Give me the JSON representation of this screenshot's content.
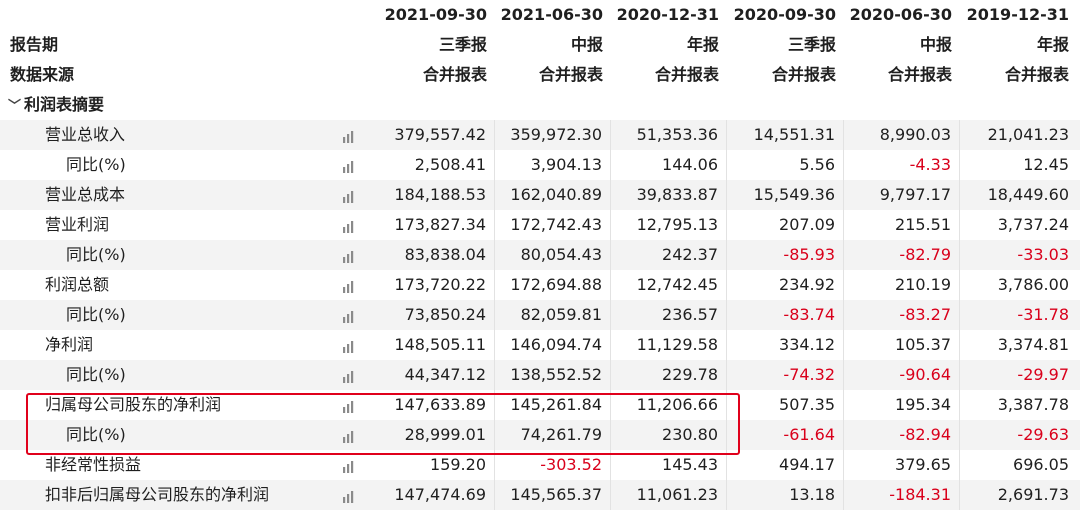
{
  "header": {
    "dates": [
      "2021-09-30",
      "2021-06-30",
      "2020-12-31",
      "2020-09-30",
      "2020-06-30",
      "2019-12-31"
    ],
    "report_period_label": "报告期",
    "report_types": [
      "三季报",
      "中报",
      "年报",
      "三季报",
      "中报",
      "年报"
    ],
    "data_source_label": "数据来源",
    "data_sources": [
      "合并报表",
      "合并报表",
      "合并报表",
      "合并报表",
      "合并报表",
      "合并报表"
    ]
  },
  "section": {
    "title": "利润表摘要",
    "chevron_icon": "chevron-down-icon"
  },
  "rows": [
    {
      "label": "营业总收入",
      "indent": 1,
      "values": [
        "379,557.42",
        "359,972.30",
        "51,353.36",
        "14,551.31",
        "8,990.03",
        "21,041.23"
      ]
    },
    {
      "label": "同比(%)",
      "indent": 2,
      "values": [
        "2,508.41",
        "3,904.13",
        "144.06",
        "5.56",
        "-4.33",
        "12.45"
      ]
    },
    {
      "label": "营业总成本",
      "indent": 1,
      "values": [
        "184,188.53",
        "162,040.89",
        "39,833.87",
        "15,549.36",
        "9,797.17",
        "18,449.60"
      ]
    },
    {
      "label": "营业利润",
      "indent": 1,
      "values": [
        "173,827.34",
        "172,742.43",
        "12,795.13",
        "207.09",
        "215.51",
        "3,737.24"
      ]
    },
    {
      "label": "同比(%)",
      "indent": 2,
      "values": [
        "83,838.04",
        "80,054.43",
        "242.37",
        "-85.93",
        "-82.79",
        "-33.03"
      ]
    },
    {
      "label": "利润总额",
      "indent": 1,
      "values": [
        "173,720.22",
        "172,694.88",
        "12,742.45",
        "234.92",
        "210.19",
        "3,786.00"
      ]
    },
    {
      "label": "同比(%)",
      "indent": 2,
      "values": [
        "73,850.24",
        "82,059.81",
        "236.57",
        "-83.74",
        "-83.27",
        "-31.78"
      ]
    },
    {
      "label": "净利润",
      "indent": 1,
      "values": [
        "148,505.11",
        "146,094.74",
        "11,129.58",
        "334.12",
        "105.37",
        "3,374.81"
      ]
    },
    {
      "label": "同比(%)",
      "indent": 2,
      "values": [
        "44,347.12",
        "138,552.52",
        "229.78",
        "-74.32",
        "-90.64",
        "-29.97"
      ]
    },
    {
      "label": "归属母公司股东的净利润",
      "indent": 1,
      "values": [
        "147,633.89",
        "145,261.84",
        "11,206.66",
        "507.35",
        "195.34",
        "3,387.78"
      ]
    },
    {
      "label": "同比(%)",
      "indent": 2,
      "values": [
        "28,999.01",
        "74,261.79",
        "230.80",
        "-61.64",
        "-82.94",
        "-29.63"
      ]
    },
    {
      "label": "非经常性损益",
      "indent": 1,
      "values": [
        "159.20",
        "-303.52",
        "145.43",
        "494.17",
        "379.65",
        "696.05"
      ]
    },
    {
      "label": "扣非后归属母公司股东的净利润",
      "indent": 1,
      "values": [
        "147,474.69",
        "145,565.37",
        "11,061.23",
        "13.18",
        "-184.31",
        "2,691.73"
      ]
    }
  ],
  "colors": {
    "negative": "#d9001b",
    "highlight_border": "#e0001b",
    "row_alt": "#f3f3f3"
  },
  "row_icon": "bar-chart-icon"
}
